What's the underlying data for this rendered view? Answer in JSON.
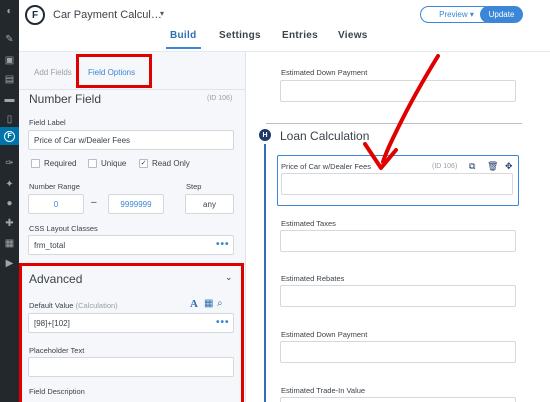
{
  "wp_sidebar": {
    "icons": [
      "dashboard-icon",
      "posts-icon",
      "media-icon",
      "pages-icon",
      "comments-icon",
      "trash-icon",
      "formidable-icon",
      "appearance-icon",
      "plugins-icon",
      "users-icon",
      "tools-icon",
      "settings-icon",
      "collapse-icon"
    ]
  },
  "header": {
    "logo_letter": "F",
    "form_title": "Car Payment Calcul…",
    "title_caret": "▾",
    "preview_label": "Preview ▾",
    "update_label": "Update",
    "tabs": [
      "Build",
      "Settings",
      "Entries",
      "Views"
    ],
    "active_tab": "Build",
    "accent_color": "#3b86d6",
    "highlight_color": "#e00000"
  },
  "options_panel": {
    "subtabs": [
      "Add Fields",
      "Field Options"
    ],
    "active_subtab": "Field Options",
    "field_type": "Number Field",
    "field_id": "(ID 106)",
    "field_label_caption": "Field Label",
    "field_label_value": "Price of Car w/Dealer Fees",
    "checkboxes": [
      {
        "label": "Required",
        "checked": false
      },
      {
        "label": "Unique",
        "checked": false
      },
      {
        "label": "Read Only",
        "checked": true
      }
    ],
    "check_mark": "✓",
    "number_range_caption": "Number Range",
    "range_min": "0",
    "range_dash": "–",
    "range_max": "9999999",
    "step_caption": "Step",
    "step_value": "any",
    "css_caption": "CSS Layout Classes",
    "css_value": "frm_total",
    "more_dots": "•••",
    "advanced_title": "Advanced",
    "advanced_chevron": "⌄",
    "default_value_caption": "Default Value",
    "default_value_note": "(Calculation)",
    "default_value": "[98]+[102]",
    "default_icons": [
      "A",
      "▦",
      "⌕"
    ],
    "placeholder_caption": "Placeholder Text",
    "placeholder_value": "",
    "description_caption": "Field Description"
  },
  "form_canvas": {
    "section_badge": "H",
    "section_title": "Loan Calculation",
    "selected_field": {
      "label": "Price of Car w/Dealer Fees",
      "id": "(ID 106)",
      "icons": [
        "⧉",
        "🗑",
        "✥"
      ]
    },
    "fields_above": [
      "Estimated Down Payment"
    ],
    "fields_below": [
      "Estimated Taxes",
      "Estimated Rebates",
      "Estimated Down Payment",
      "Estimated Trade-In Value"
    ]
  }
}
